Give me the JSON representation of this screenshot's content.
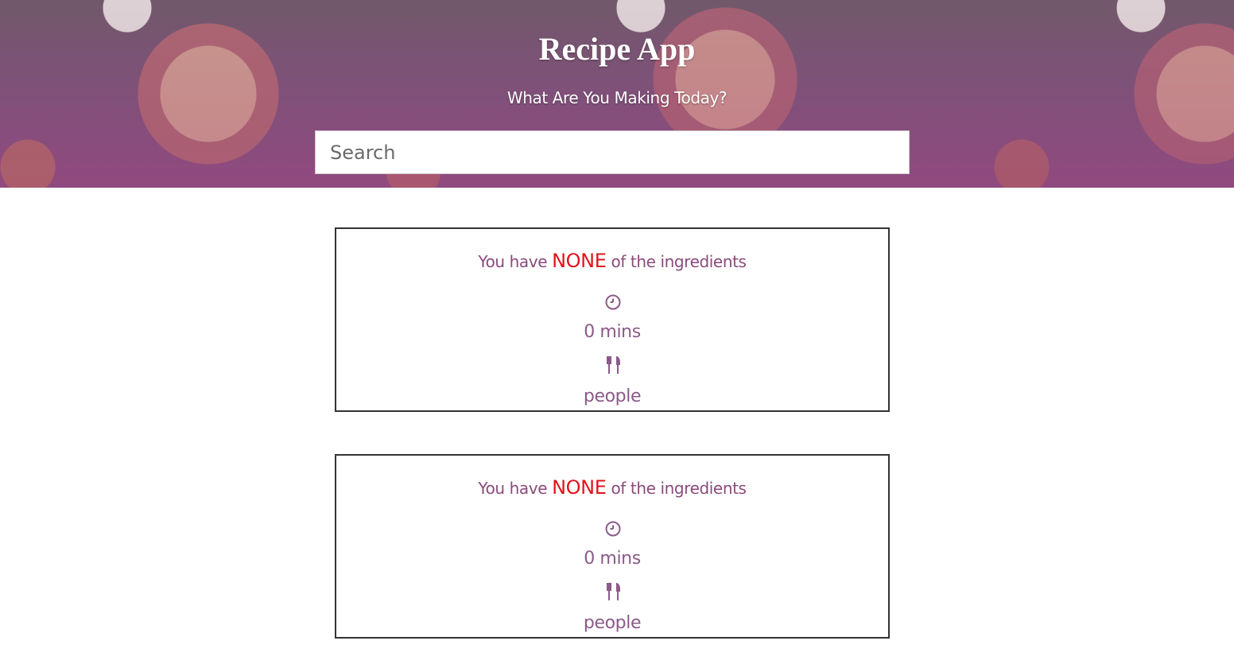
{
  "header": {
    "title": "Recipe App",
    "subtitle": "What Are You Making Today?"
  },
  "search": {
    "placeholder": "Search",
    "value": ""
  },
  "recipes": [
    {
      "ingredients_prefix": "You have",
      "ingredients_status": "NONE",
      "ingredients_suffix": "of the ingredients",
      "time": "0 mins",
      "servings": "people",
      "time_icon": "clock-icon",
      "servings_icon": "cutlery-icon"
    },
    {
      "ingredients_prefix": "You have",
      "ingredients_status": "NONE",
      "ingredients_suffix": "of the ingredients",
      "time": "0 mins",
      "servings": "people",
      "time_icon": "clock-icon",
      "servings_icon": "cutlery-icon"
    }
  ],
  "colors": {
    "accent": "#8a4a7c",
    "none_status": "#e0141c",
    "card_border": "#333333"
  }
}
